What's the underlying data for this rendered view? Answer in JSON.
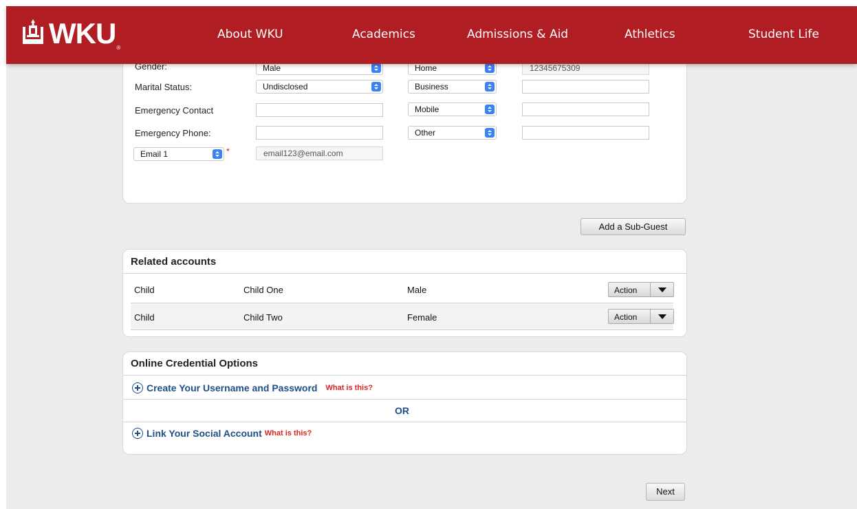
{
  "header": {
    "logo_text": "WKU",
    "logo_registered": "®",
    "nav": [
      "About WKU",
      "Academics",
      "Admissions & Aid",
      "Athletics",
      "Student Life"
    ]
  },
  "personal_info": {
    "gender_label": "Gender:",
    "gender_value": "Male",
    "phone1_type": "Home",
    "phone1_value": "12345675309",
    "marital_label": "Marital Status:",
    "marital_value": "Undisclosed",
    "phone2_type": "Business",
    "phone2_value": "",
    "emergency_contact_label": "Emergency Contact",
    "emergency_contact_value": "",
    "phone3_type": "Mobile",
    "phone3_value": "",
    "emergency_phone_label": "Emergency Phone:",
    "emergency_phone_value": "",
    "phone4_type": "Other",
    "phone4_value": "",
    "email_type": "Email 1",
    "required_mark": "*",
    "email_value": "email123@email.com"
  },
  "add_subguest_label": "Add a Sub-Guest",
  "related_accounts": {
    "title": "Related accounts",
    "rows": [
      {
        "relation": "Child",
        "name": "Child One",
        "gender": "Male",
        "action": "Action"
      },
      {
        "relation": "Child",
        "name": "Child Two",
        "gender": "Female",
        "action": "Action"
      }
    ]
  },
  "credentials": {
    "title": "Online Credential Options",
    "create_label": "Create Your Username and Password",
    "create_help": "What is this?",
    "or_label": "OR",
    "link_label": "Link Your Social Account",
    "link_help": "What is this?"
  },
  "next_label": "Next",
  "colors": {
    "brand_red": "#b01e24",
    "link_blue": "#1d4f86",
    "help_red": "#e0211d",
    "select_blue": "#3b82f6"
  }
}
